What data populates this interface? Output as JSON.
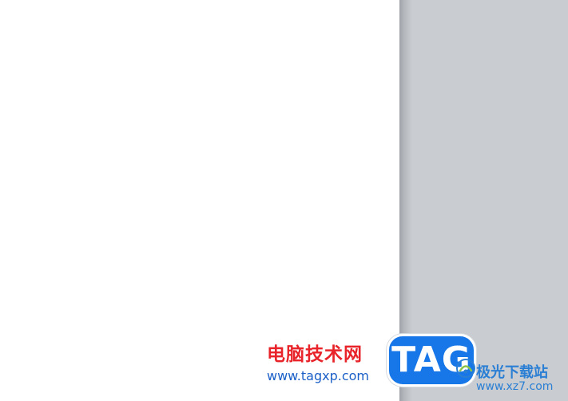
{
  "document": {
    "page_color": "#ffffff",
    "workspace_color": "#c9ccd1"
  },
  "watermark": {
    "cn_title": "电脑技术网",
    "cn_title_color": "#e8242a",
    "cn_url": "www.tagxp.com",
    "cn_url_color": "#1a5fc7",
    "tag_label": "TAG",
    "tag_badge_color": "#1877e8",
    "site_name": "极光下载站",
    "site_name_color": "#2a7fd4",
    "site_url": "www.xz7.com",
    "site_url_color": "#2a7fd4",
    "site_logo_icon": "aurora-logo-icon"
  }
}
